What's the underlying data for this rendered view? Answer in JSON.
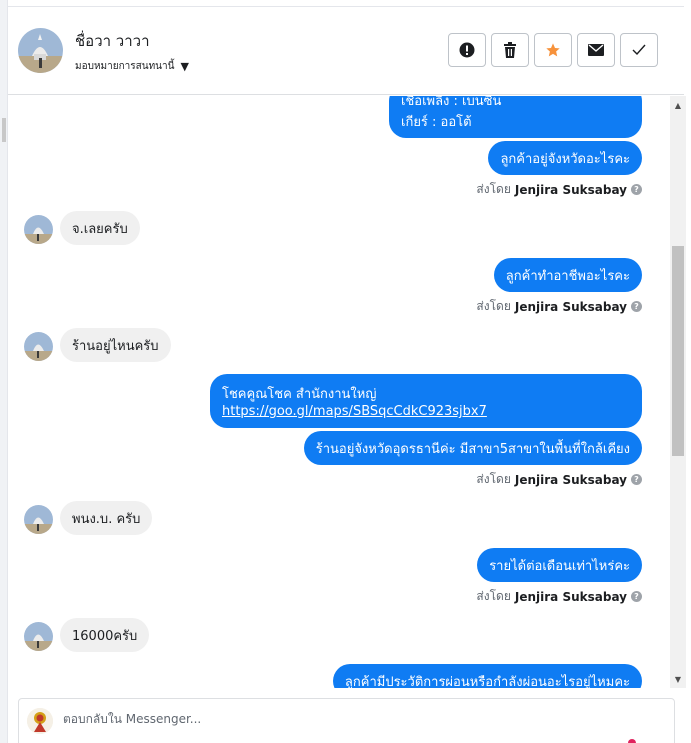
{
  "header": {
    "name": "ชื่อวา วาวา",
    "assign_label": "มอบหมายการสนทนานี้",
    "actions": [
      "report",
      "delete",
      "star",
      "mark-unread",
      "done"
    ]
  },
  "messages": {
    "m1_line1": "เชื้อเพลิง : เบนซิน",
    "m1_line2": "เกียร์ : ออโต้",
    "m2": "ลูกค้าอยู่จังหวัดอะไรคะ",
    "sent1_prefix": "ส่งโดย",
    "sent1_name": "Jenjira Suksabay",
    "in1": "จ.เลยครับ",
    "m3": "ลูกค้าทำอาชีพอะไรคะ",
    "sent2_prefix": "ส่งโดย",
    "sent2_name": "Jenjira Suksabay",
    "in2": "ร้านอยู่ไหนครับ",
    "m4_line1": "โชคคูณโชค สำนักงานใหญ่",
    "m4_link": "https://goo.gl/maps/SBSqcCdkC923sjbx7",
    "m5": "ร้านอยู่จังหวัดอุดรธานีค่ะ มีสาขา5สาขาในพื้นที่ใกล้เคียง",
    "sent3_prefix": "ส่งโดย",
    "sent3_name": "Jenjira Suksabay",
    "in3": "พนง.บ. ครับ",
    "m6": "รายได้ต่อเดือนเท่าไหร่คะ",
    "sent4_prefix": "ส่งโดย",
    "sent4_name": "Jenjira Suksabay",
    "in4": "16000ครับ",
    "m7": "ลูกค้ามีประวัติการผ่อนหรือกำลังผ่อนอะไรอยู่ไหมคะ"
  },
  "composer": {
    "placeholder": "ตอบกลับใน Messenger..."
  },
  "colors": {
    "outgoing_bubble": "#0f7cf3",
    "incoming_bubble": "#f0f0f0",
    "star": "#f7923b"
  },
  "icons": [
    "exclamation-icon",
    "trash-icon",
    "star-icon",
    "envelope-icon",
    "check-icon",
    "caret-down-icon",
    "question-icon"
  ]
}
